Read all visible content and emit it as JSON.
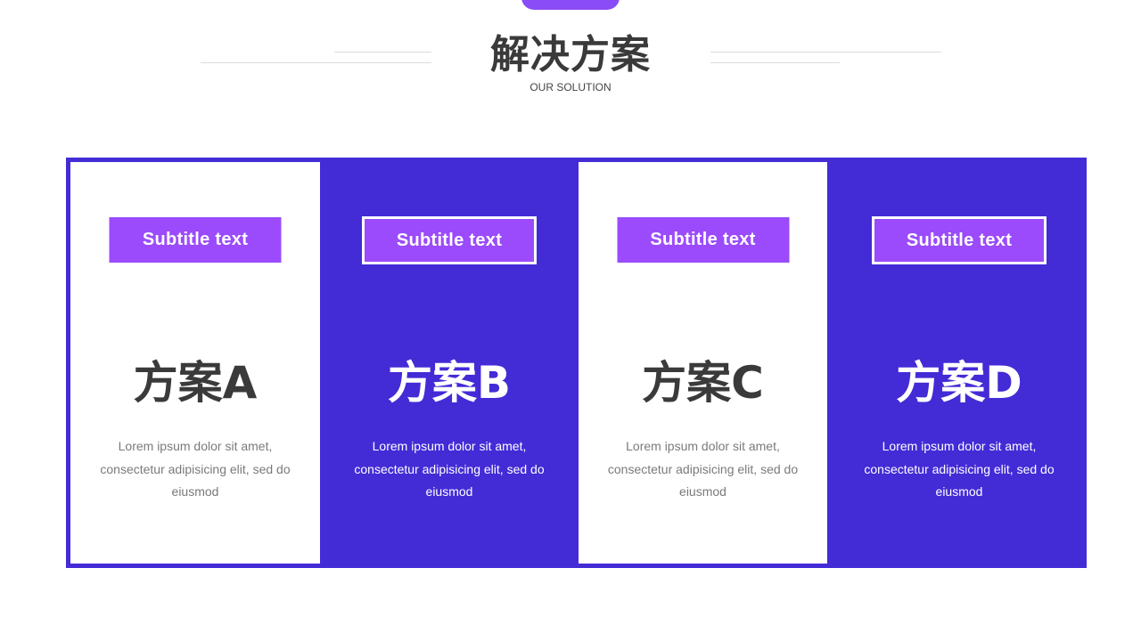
{
  "header": {
    "title": "解决方案",
    "subtitle": "OUR SOLUTION"
  },
  "colors": {
    "accent_purple": "#9b4bfb",
    "panel_blue": "#432bd6",
    "title_gray": "#3a3a3a"
  },
  "cards": [
    {
      "badge": "Subtitle text",
      "name": "方案A",
      "description": "Lorem ipsum dolor sit amet, consectetur adipisicing elit, sed do eiusmod"
    },
    {
      "badge": "Subtitle text",
      "name": "方案B",
      "description": "Lorem ipsum dolor sit amet, consectetur adipisicing elit, sed do eiusmod"
    },
    {
      "badge": "Subtitle text",
      "name": "方案C",
      "description": "Lorem ipsum dolor sit amet, consectetur adipisicing elit, sed do eiusmod"
    },
    {
      "badge": "Subtitle text",
      "name": "方案D",
      "description": "Lorem ipsum dolor sit amet, consectetur adipisicing elit, sed do eiusmod"
    }
  ]
}
